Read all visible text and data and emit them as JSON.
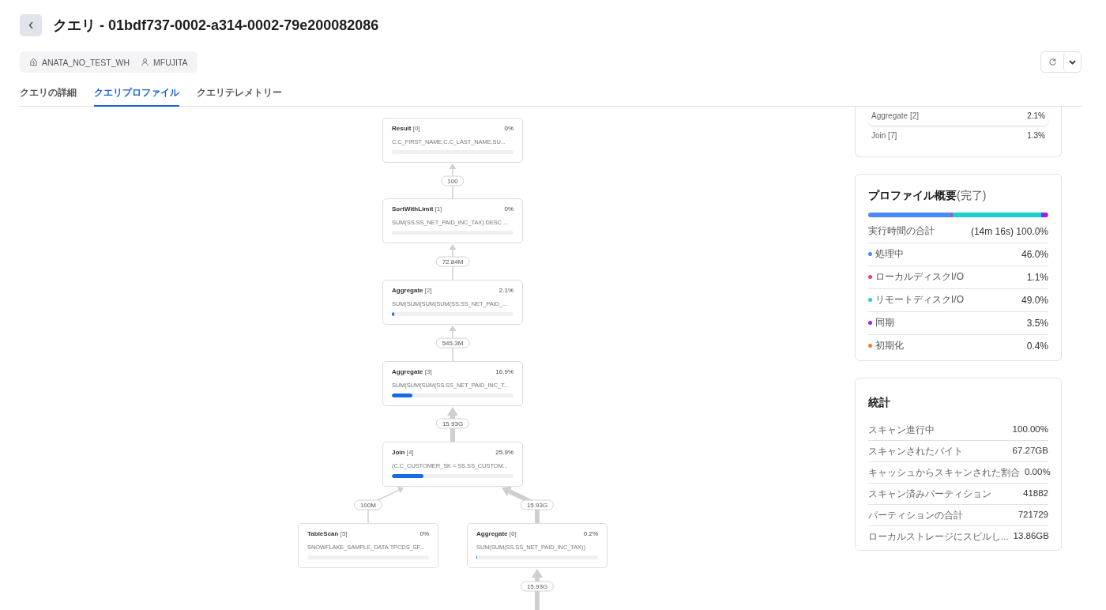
{
  "header": {
    "title": "クエリ - 01bdf737-0002-a314-0002-79e200082086",
    "warehouse": "ANATA_NO_TEST_WH",
    "user": "MFUJITA"
  },
  "tabs": [
    {
      "label": "クエリの詳細",
      "selected": false
    },
    {
      "label": "クエリプロファイル",
      "selected": true
    },
    {
      "label": "クエリテレメトリー",
      "selected": false
    }
  ],
  "graph": {
    "nodes": [
      {
        "name": "Result",
        "index": "[0]",
        "percent": "0%",
        "detail": "C.C_FIRST_NAME,C.C_LAST_NAME,SU..."
      },
      {
        "name": "SortWithLimit",
        "index": "[1]",
        "percent": "0%",
        "detail": "SUM(SS.SS_NET_PAID_INC_TAX) DESC ..."
      },
      {
        "name": "Aggregate",
        "index": "[2]",
        "percent": "2.1%",
        "detail": "SUM(SUM(SUM(SUM(SS.SS_NET_PAID_...",
        "level": 0.021
      },
      {
        "name": "Aggregate",
        "index": "[3]",
        "percent": "16.9%",
        "detail": "SUM(SUM(SUM(SS.SS_NET_PAID_INC_T...",
        "level": 0.169
      },
      {
        "name": "Join",
        "index": "[4]",
        "percent": "25.9%",
        "detail": "(C.C_CUSTOMER_SK = SS.SS_CUSTOM...",
        "level": 0.259
      },
      {
        "name": "TableScan",
        "index": "[5]",
        "percent": "0%",
        "detail": "SNOWFLAKE_SAMPLE_DATA.TPCDS_SF..."
      },
      {
        "name": "Aggregate",
        "index": "[6]",
        "percent": "0.2%",
        "detail": "SUM(SUM(SS.SS_NET_PAID_INC_TAX))",
        "level": 0.002
      }
    ],
    "edges": [
      {
        "label": "100"
      },
      {
        "label": "72.84M"
      },
      {
        "label": "545.3M"
      },
      {
        "label": "15.93G"
      },
      {
        "label": "100M"
      },
      {
        "label": "15.93G"
      },
      {
        "label": "15.93G"
      }
    ]
  },
  "top_operators": [
    {
      "name": "Aggregate [2]",
      "value": "2.1%",
      "selected": true
    },
    {
      "name": "Join [7]",
      "value": "1.3%",
      "selected": false
    }
  ],
  "profile_overview": {
    "title": "プロファイル概要",
    "status": "(完了)",
    "total_label": "実行時間の合計",
    "total_value": "(14m 16s) 100.0%",
    "items": [
      {
        "label": "処理中",
        "value": "46.0%",
        "color": "#4a8af4"
      },
      {
        "label": "ローカルディスクI/O",
        "value": "1.1%",
        "color": "#e8436e"
      },
      {
        "label": "リモートディスクI/O",
        "value": "49.0%",
        "color": "#1ccfcf"
      },
      {
        "label": "同期",
        "value": "3.5%",
        "color": "#9b22e6"
      },
      {
        "label": "初期化",
        "value": "0.4%",
        "color": "#f97b2a"
      }
    ]
  },
  "statistics": {
    "title": "統計",
    "rows": [
      {
        "label": "スキャン進行中",
        "value": "100.00%"
      },
      {
        "label": "スキャンされたバイト",
        "value": "67.27GB"
      },
      {
        "label": "キャッシュからスキャンされた割合",
        "value": "0.00%"
      },
      {
        "label": "スキャン済みパーティション",
        "value": "41882"
      },
      {
        "label": "パーティションの合計",
        "value": "721729"
      },
      {
        "label": "ローカルストレージにスピルし...",
        "value": "13.86GB"
      }
    ]
  }
}
